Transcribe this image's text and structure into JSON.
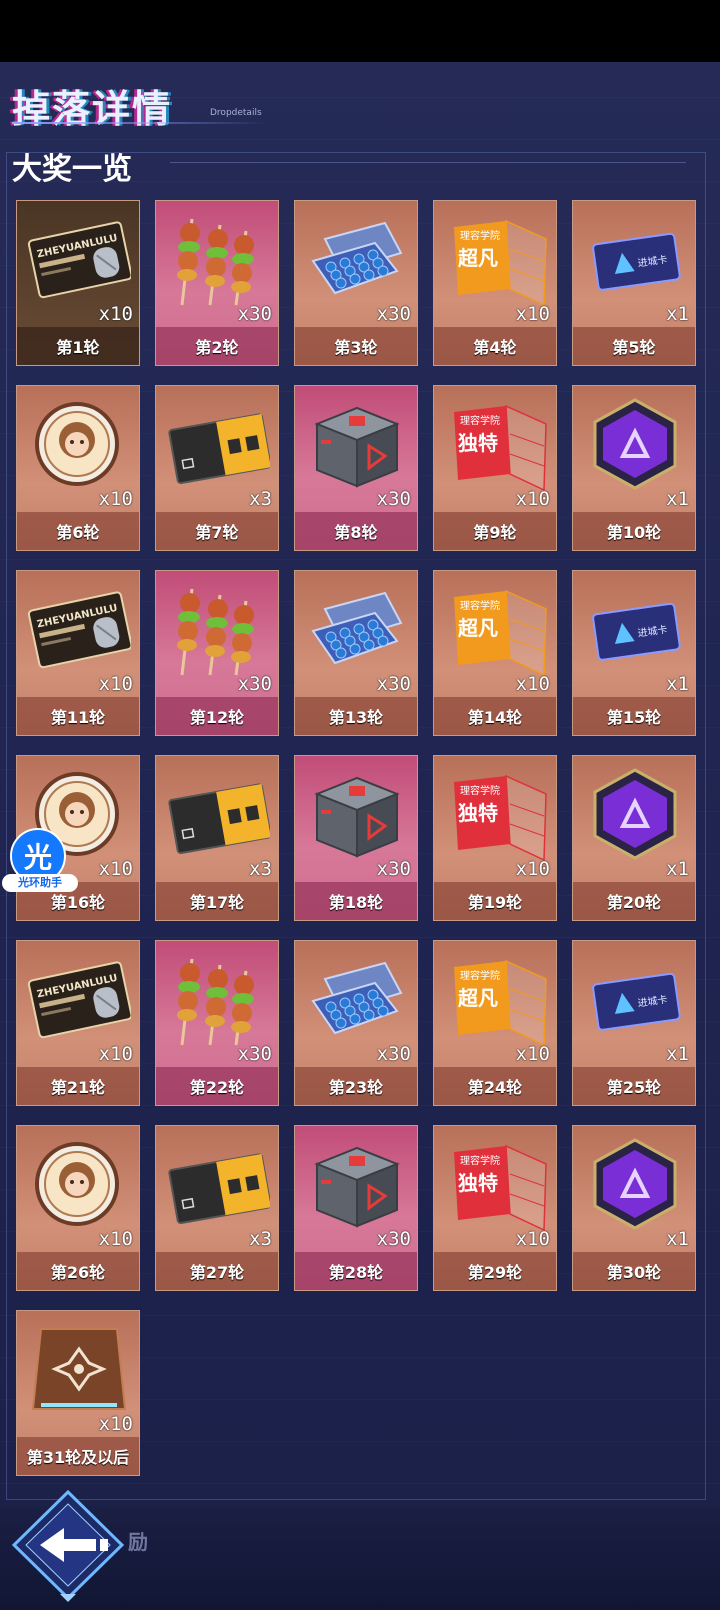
{
  "header": {
    "title": "掉落详情",
    "subtitle": "Dropdetails",
    "section": "大奖一览"
  },
  "cards": [
    {
      "label": "第1轮",
      "count": "x10",
      "icon": "ticket",
      "tone": "dark"
    },
    {
      "label": "第2轮",
      "count": "x30",
      "icon": "skewers",
      "tone": "pink"
    },
    {
      "label": "第3轮",
      "count": "x30",
      "icon": "case",
      "tone": "orange"
    },
    {
      "label": "第4轮",
      "count": "x10",
      "icon": "pass-orange",
      "tone": "orange"
    },
    {
      "label": "第5轮",
      "count": "x1",
      "icon": "card",
      "tone": "orange"
    },
    {
      "label": "第6轮",
      "count": "x10",
      "icon": "badge-coin",
      "tone": "orange"
    },
    {
      "label": "第7轮",
      "count": "x3",
      "icon": "chip-card",
      "tone": "orange"
    },
    {
      "label": "第8轮",
      "count": "x30",
      "icon": "cube-box",
      "tone": "pink"
    },
    {
      "label": "第9轮",
      "count": "x10",
      "icon": "pass-red",
      "tone": "orange"
    },
    {
      "label": "第10轮",
      "count": "x1",
      "icon": "hex-gem",
      "tone": "orange"
    },
    {
      "label": "第11轮",
      "count": "x10",
      "icon": "ticket",
      "tone": "orange"
    },
    {
      "label": "第12轮",
      "count": "x30",
      "icon": "skewers",
      "tone": "pink"
    },
    {
      "label": "第13轮",
      "count": "x30",
      "icon": "case",
      "tone": "orange"
    },
    {
      "label": "第14轮",
      "count": "x10",
      "icon": "pass-orange",
      "tone": "orange"
    },
    {
      "label": "第15轮",
      "count": "x1",
      "icon": "card",
      "tone": "orange"
    },
    {
      "label": "第16轮",
      "count": "x10",
      "icon": "badge-coin",
      "tone": "orange"
    },
    {
      "label": "第17轮",
      "count": "x3",
      "icon": "chip-card",
      "tone": "orange"
    },
    {
      "label": "第18轮",
      "count": "x30",
      "icon": "cube-box",
      "tone": "pink"
    },
    {
      "label": "第19轮",
      "count": "x10",
      "icon": "pass-red",
      "tone": "orange"
    },
    {
      "label": "第20轮",
      "count": "x1",
      "icon": "hex-gem",
      "tone": "orange"
    },
    {
      "label": "第21轮",
      "count": "x10",
      "icon": "ticket",
      "tone": "orange"
    },
    {
      "label": "第22轮",
      "count": "x30",
      "icon": "skewers",
      "tone": "pink"
    },
    {
      "label": "第23轮",
      "count": "x30",
      "icon": "case",
      "tone": "orange"
    },
    {
      "label": "第24轮",
      "count": "x10",
      "icon": "pass-orange",
      "tone": "orange"
    },
    {
      "label": "第25轮",
      "count": "x1",
      "icon": "card",
      "tone": "orange"
    },
    {
      "label": "第26轮",
      "count": "x10",
      "icon": "badge-coin",
      "tone": "orange"
    },
    {
      "label": "第27轮",
      "count": "x3",
      "icon": "chip-card",
      "tone": "orange"
    },
    {
      "label": "第28轮",
      "count": "x30",
      "icon": "cube-box",
      "tone": "pink"
    },
    {
      "label": "第29轮",
      "count": "x10",
      "icon": "pass-red",
      "tone": "orange"
    },
    {
      "label": "第30轮",
      "count": "x1",
      "icon": "hex-gem",
      "tone": "orange"
    },
    {
      "label": "第31轮及以后",
      "count": "x10",
      "icon": "crest-plate",
      "tone": "orange"
    }
  ],
  "item_text": {
    "ticket_title": "ZHEYUANLULU",
    "pass_header": "理容学院",
    "pass_orange_word": "超凡",
    "pass_red_word": "独特",
    "card_text": "进城卡"
  },
  "floating_badge": {
    "glyph": "光",
    "label": "光环助手"
  },
  "footer": {
    "text": "励"
  }
}
